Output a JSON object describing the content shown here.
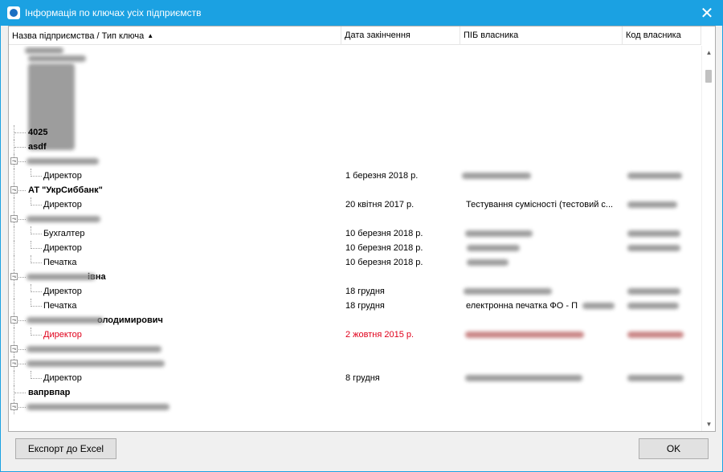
{
  "window": {
    "title": "Інформація по ключах усіх підприємств",
    "close_glyph": "✕"
  },
  "columns": [
    {
      "label": "Назва підприємства / Тип ключа",
      "sort": "▲"
    },
    {
      "label": "Дата закінчення"
    },
    {
      "label": "ПІБ власника"
    },
    {
      "label": "Код власника"
    }
  ],
  "rows": [
    {
      "level": 0,
      "name": "4025",
      "bold": true,
      "partial": true
    },
    {
      "level": 0,
      "name": "asdf",
      "bold": true
    },
    {
      "level": 0,
      "name": "",
      "bold": true,
      "expander": "⊟"
    },
    {
      "level": 1,
      "name": "Директор",
      "date": "1 березня 2018 р.",
      "owner": "",
      "code": ""
    },
    {
      "level": 0,
      "name": "АТ \"УкрСиббанк\"",
      "bold": true,
      "expander": "⊟"
    },
    {
      "level": 1,
      "name": "Директор",
      "date": "20 квітня 2017 р.",
      "owner": "Тестування сумісності (тестовий с...",
      "code": ""
    },
    {
      "level": 0,
      "name": "",
      "bold": true,
      "expander": "⊟"
    },
    {
      "level": 1,
      "name": "Бухгалтер",
      "date": "10 березня 2018 р.",
      "owner": "",
      "code": ""
    },
    {
      "level": 1,
      "name": "Директор",
      "date": "10 березня 2018 р.",
      "owner": "",
      "code": ""
    },
    {
      "level": 1,
      "name": "Печатка",
      "date": "10 березня 2018 р.",
      "owner": "",
      "code": ""
    },
    {
      "level": 0,
      "name": "івна",
      "bold": true,
      "expander": "⊟"
    },
    {
      "level": 1,
      "name": "Директор",
      "date": "18 грудня",
      "owner": "",
      "code": ""
    },
    {
      "level": 1,
      "name": "Печатка",
      "date": "18 грудня",
      "owner": "електронна печатка ФО - П",
      "code": ""
    },
    {
      "level": 0,
      "name": "олодимирович",
      "bold": true,
      "expander": "⊟"
    },
    {
      "level": 1,
      "name": "Директор",
      "date": "2 жовтня 2015 р.",
      "owner": "",
      "code": "",
      "expired": true
    },
    {
      "level": 0,
      "name": "",
      "bold": true,
      "expander": "⊟"
    },
    {
      "level": 0,
      "name": "",
      "bold": true,
      "expander": "⊟"
    },
    {
      "level": 1,
      "name": "Директор",
      "date": "8 грудня",
      "owner": "",
      "code": ""
    },
    {
      "level": 0,
      "name": "вапрвпар",
      "bold": true
    },
    {
      "level": 0,
      "name": "",
      "bold": true,
      "expander": "⊟"
    }
  ],
  "scrollbar": {
    "up_glyph": "▲",
    "down_glyph": "▼"
  },
  "buttons": {
    "export": "Експорт до Excel",
    "ok": "OK"
  },
  "colors": {
    "titlebar": "#1ba1e2",
    "expired_text": "#e0001b"
  }
}
